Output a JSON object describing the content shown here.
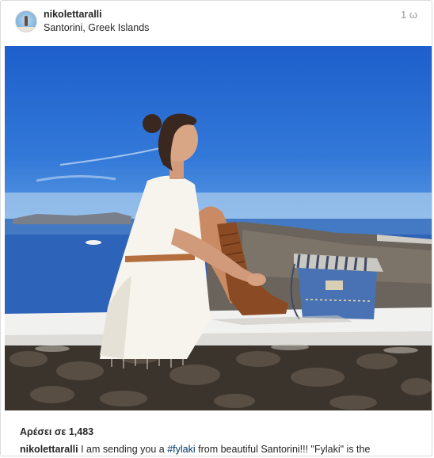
{
  "post": {
    "username": "nikolettaralli",
    "location": "Santorini, Greek Islands",
    "time": "1 ω",
    "photo_icon": "post-photo"
  },
  "engagement": {
    "likes_prefix": "Αρέσει σε",
    "likes_count": "1,483"
  },
  "caption": {
    "username": "nikolettaralli",
    "text_before": " I am sending you a ",
    "hashtag": "#fylaki",
    "text_after": " from beautiful Santorini!!! \"Fylaki\" is the"
  },
  "colors": {
    "text": "#262626",
    "muted": "#999999",
    "hashtag": "#003569",
    "border": "#dbdbdb"
  }
}
